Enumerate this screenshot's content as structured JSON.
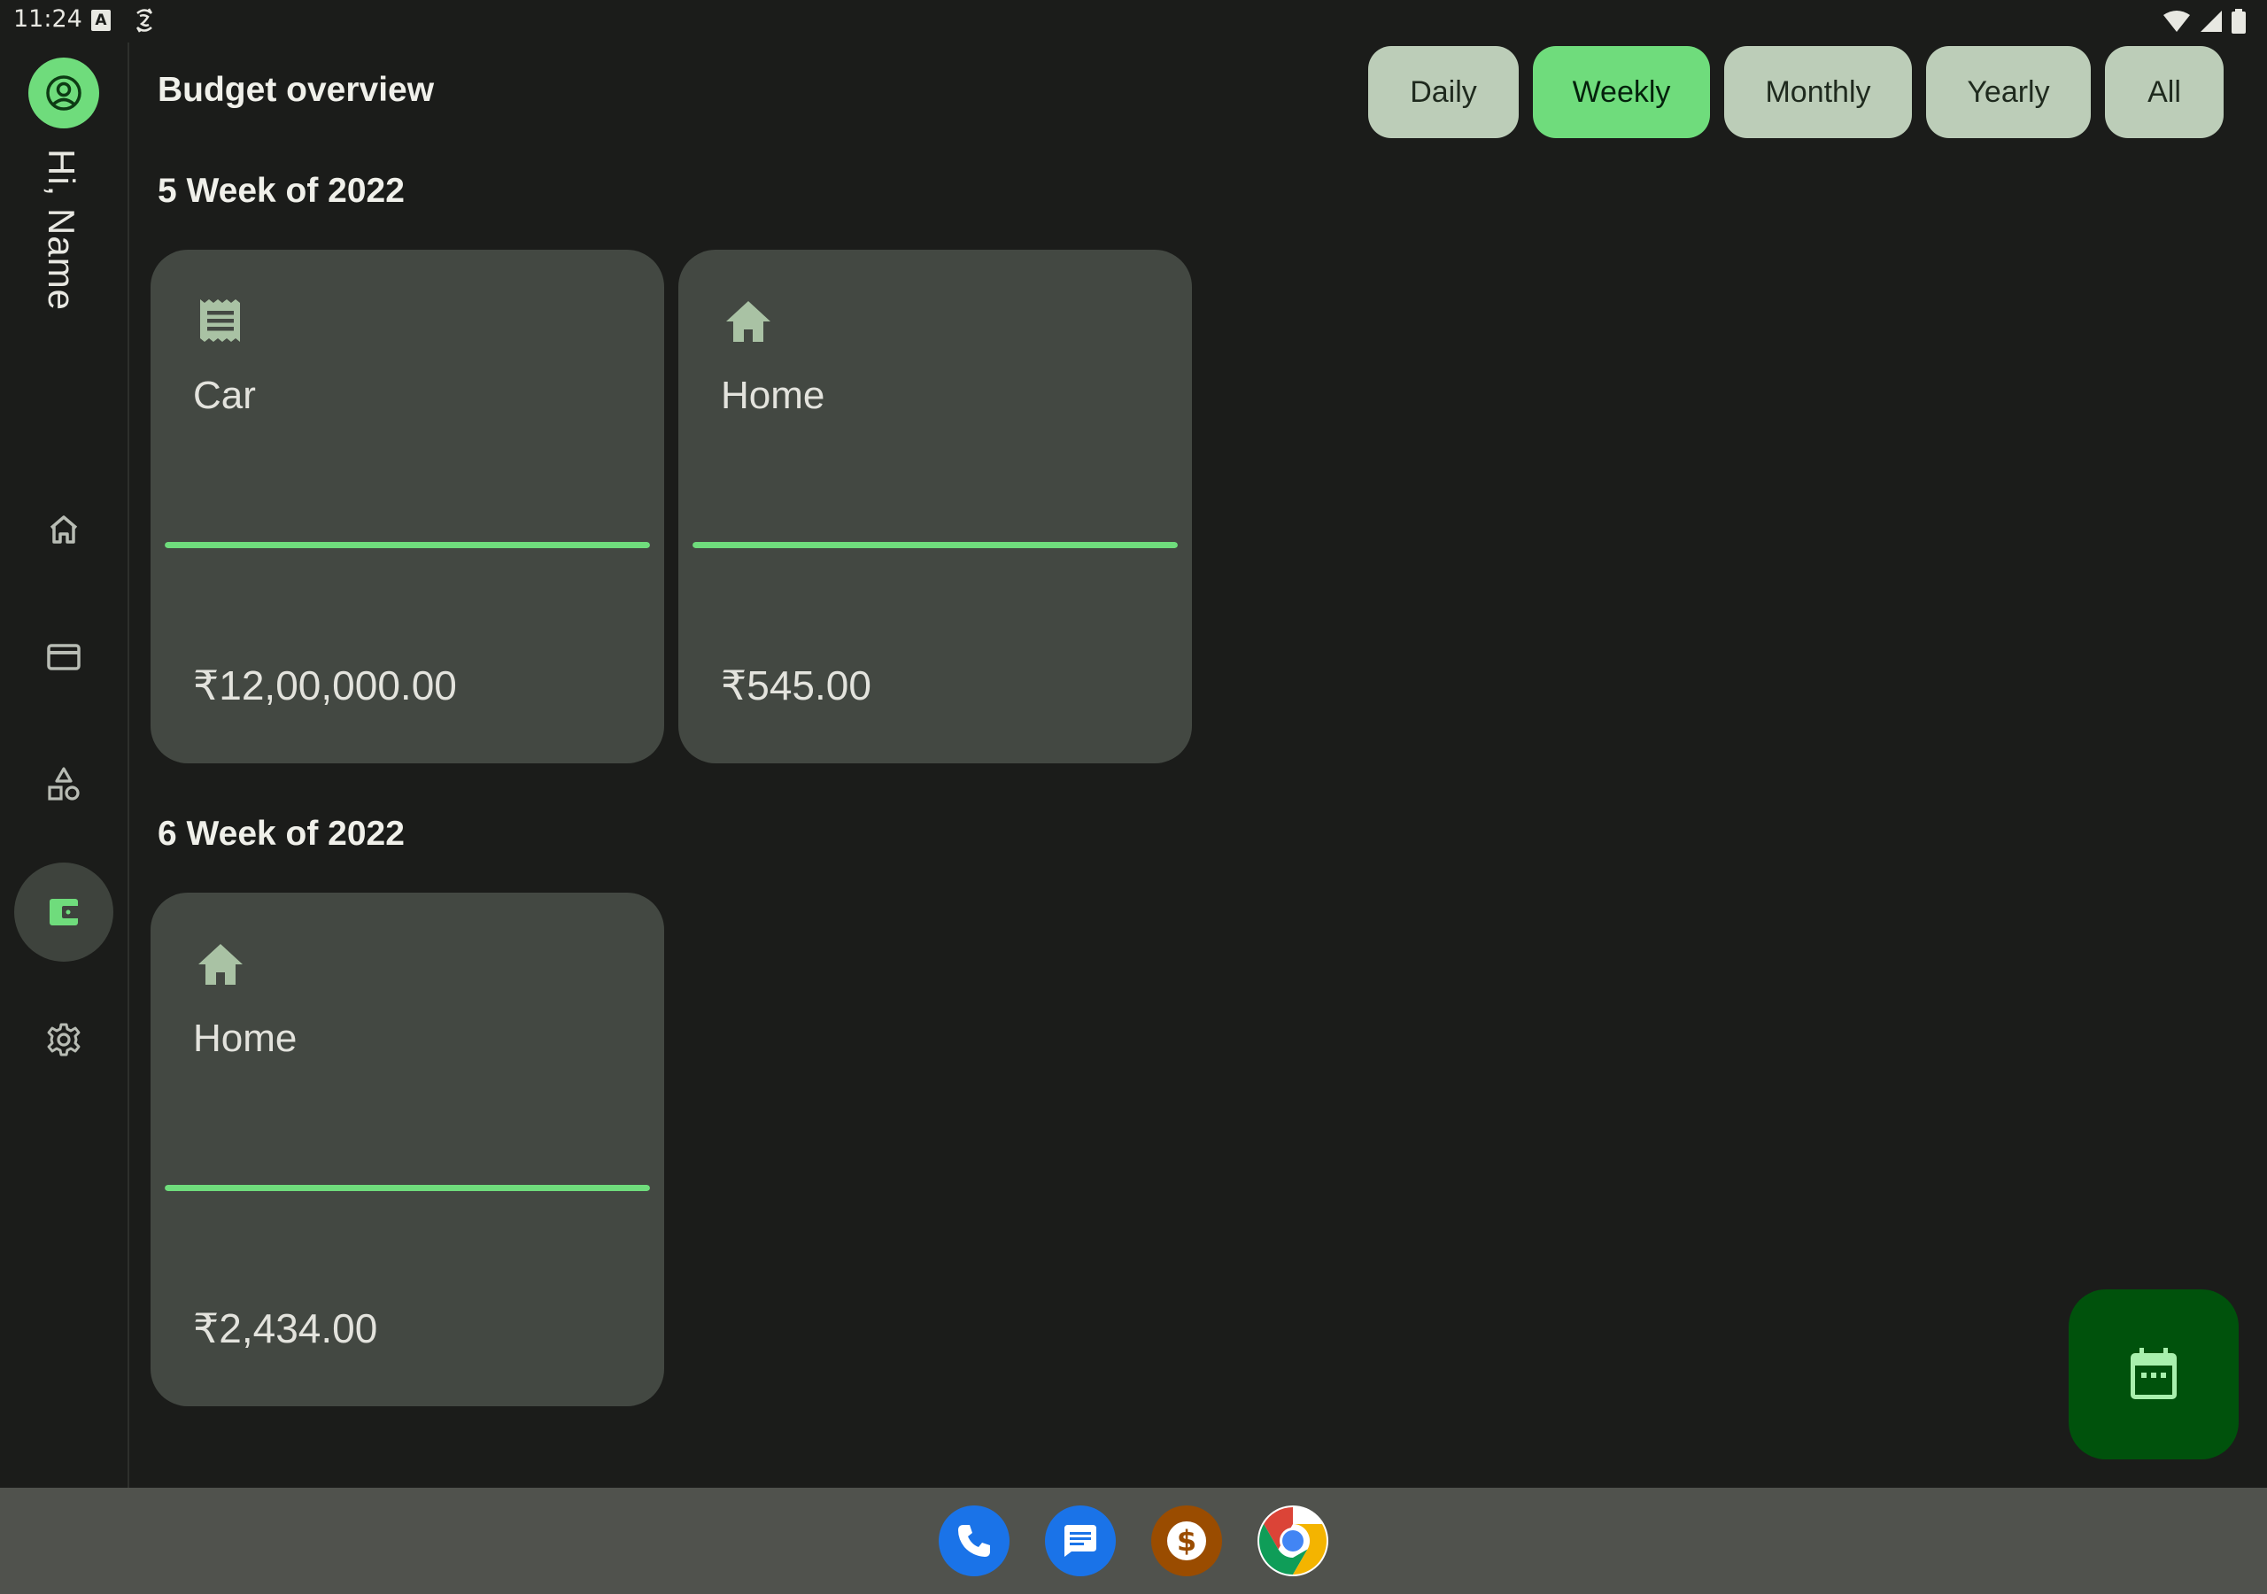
{
  "status_bar": {
    "time": "11:24"
  },
  "nav_rail": {
    "greeting": "Hi, Name",
    "items": [
      {
        "name": "home",
        "icon": "home-outline-icon",
        "active": false
      },
      {
        "name": "accounts",
        "icon": "credit-card-icon",
        "active": false
      },
      {
        "name": "categories",
        "icon": "shapes-icon",
        "active": false
      },
      {
        "name": "budgets",
        "icon": "wallet-icon",
        "active": true
      },
      {
        "name": "settings",
        "icon": "gear-icon",
        "active": false
      }
    ]
  },
  "header": {
    "title": "Budget overview"
  },
  "filters": {
    "chips": [
      "Daily",
      "Weekly",
      "Monthly",
      "Yearly",
      "All"
    ],
    "selected": "Weekly"
  },
  "sections": [
    {
      "title": "5 Week of 2022",
      "cards": [
        {
          "icon": "receipt-icon",
          "name": "Car",
          "amount": "₹12,00,000.00",
          "progress": 1.0
        },
        {
          "icon": "house-icon",
          "name": "Home",
          "amount": "₹545.00",
          "progress": 1.0
        }
      ]
    },
    {
      "title": "6 Week of 2022",
      "cards": [
        {
          "icon": "house-icon",
          "name": "Home",
          "amount": "₹2,434.00",
          "progress": 1.0
        }
      ]
    }
  ],
  "fab": {
    "icon": "calendar-icon"
  },
  "taskbar": {
    "apps": [
      {
        "name": "phone",
        "icon": "phone-icon",
        "color": "#1a73e8"
      },
      {
        "name": "messages",
        "icon": "message-icon",
        "color": "#1a73e8"
      },
      {
        "name": "budget-app",
        "icon": "dollar-icon",
        "color": "#9a4c00"
      },
      {
        "name": "chrome",
        "icon": "chrome-icon",
        "color": "#ffffff"
      }
    ]
  },
  "colors": {
    "accent": "#6fdc7c",
    "background": "#1b1c1a",
    "card": "#434842",
    "chip": "#bccdb8",
    "fab": "#00520c"
  }
}
